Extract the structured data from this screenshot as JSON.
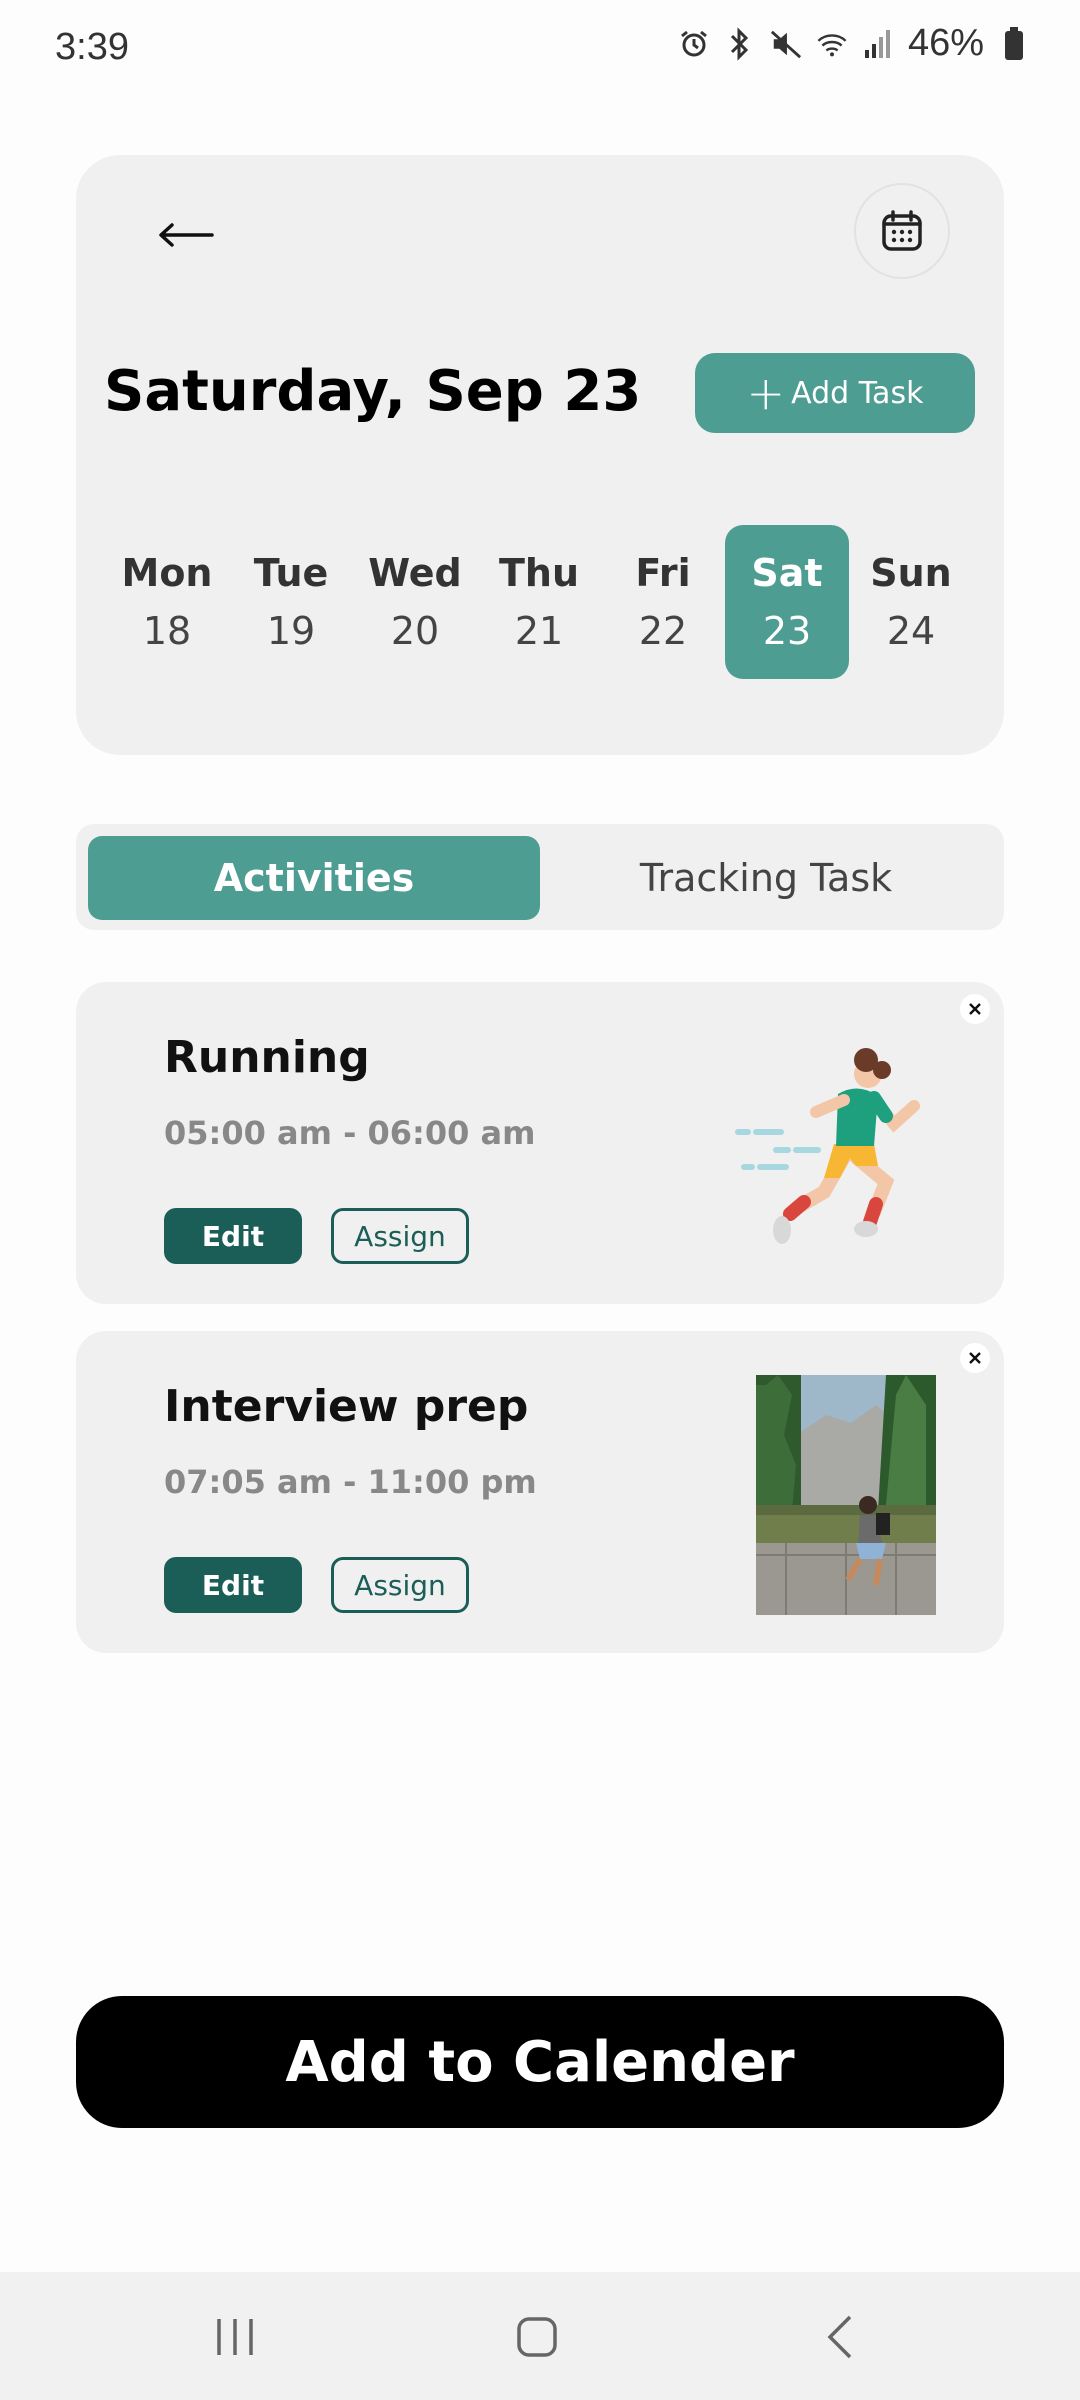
{
  "status_bar": {
    "time": "3:39",
    "battery_percent": "46%",
    "icons": [
      "alarm-icon",
      "bluetooth-icon",
      "mute-icon",
      "wifi-icon",
      "signal-icon",
      "battery-icon"
    ]
  },
  "header": {
    "date_title": "Saturday, Sep 23",
    "add_task_label": "Add Task",
    "back_icon": "arrow-left-icon",
    "calendar_icon": "calendar-icon"
  },
  "week": {
    "days": [
      {
        "name": "Mon",
        "num": "18"
      },
      {
        "name": "Tue",
        "num": "19"
      },
      {
        "name": "Wed",
        "num": "20"
      },
      {
        "name": "Thu",
        "num": "21"
      },
      {
        "name": "Fri",
        "num": "22"
      },
      {
        "name": "Sat",
        "num": "23"
      },
      {
        "name": "Sun",
        "num": "24"
      }
    ],
    "selected_index": 5
  },
  "tabs": {
    "activities": "Activities",
    "tracking": "Tracking Task"
  },
  "activities": [
    {
      "title": "Running",
      "time": "05:00 am - 06:00 am",
      "edit": "Edit",
      "assign": "Assign",
      "image": "runner-illustration"
    },
    {
      "title": "Interview prep",
      "time": "07:05 am - 11:00 pm",
      "edit": "Edit",
      "assign": "Assign",
      "image": "hiker-photo"
    }
  ],
  "footer": {
    "add_calendar_label": "Add to Calender"
  },
  "colors": {
    "accent": "#4e9d92",
    "accent_dark": "#1b5e58",
    "card_bg": "#f0f0f0"
  }
}
